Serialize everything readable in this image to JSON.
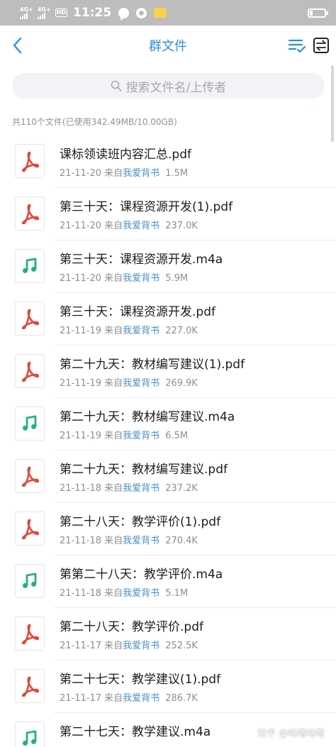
{
  "status_bar": {
    "sim1_network": "4G+",
    "sim2_network": "4G+",
    "hd_label": "HD",
    "time": "11:25",
    "battery_level": 0.2,
    "icons": [
      "chat-bubble-icon",
      "browser-icon",
      "app-icon"
    ]
  },
  "nav": {
    "title": "群文件",
    "back_icon": "chevron-left-icon",
    "sort_icon": "sort-check-icon",
    "transfer_icon": "transfer-icon"
  },
  "search": {
    "placeholder": "搜索文件名/上传者"
  },
  "summary": "共110个文件(已使用342.49MB/10.00GB)",
  "meta_prefix": "来自",
  "files": [
    {
      "name": "课标领读班内容汇总.pdf",
      "date": "21-11-20",
      "uploader": "我爱背书",
      "size": "1.5M",
      "type": "pdf"
    },
    {
      "name": "第三十天：课程资源开发(1).pdf",
      "date": "21-11-20",
      "uploader": "我爱背书",
      "size": "237.0K",
      "type": "pdf"
    },
    {
      "name": "第三十天：课程资源开发.m4a",
      "date": "21-11-20",
      "uploader": "我爱背书",
      "size": "5.9M",
      "type": "audio"
    },
    {
      "name": "第三十天：课程资源开发.pdf",
      "date": "21-11-19",
      "uploader": "我爱背书",
      "size": "227.0K",
      "type": "pdf"
    },
    {
      "name": "第二十九天：教材编写建议(1).pdf",
      "date": "21-11-19",
      "uploader": "我爱背书",
      "size": "269.9K",
      "type": "pdf"
    },
    {
      "name": "第二十九天：教材编写建议.m4a",
      "date": "21-11-19",
      "uploader": "我爱背书",
      "size": "6.5M",
      "type": "audio"
    },
    {
      "name": "第二十九天：教材编写建议.pdf",
      "date": "21-11-18",
      "uploader": "我爱背书",
      "size": "237.2K",
      "type": "pdf"
    },
    {
      "name": "第二十八天：教学评价(1).pdf",
      "date": "21-11-18",
      "uploader": "我爱背书",
      "size": "270.4K",
      "type": "pdf"
    },
    {
      "name": "第第二十八天：教学评价.m4a",
      "date": "21-11-18",
      "uploader": "我爱背书",
      "size": "5.1M",
      "type": "audio"
    },
    {
      "name": "第二十八天：教学评价.pdf",
      "date": "21-11-17",
      "uploader": "我爱背书",
      "size": "252.5K",
      "type": "pdf"
    },
    {
      "name": "第二十七天：教学建议(1).pdf",
      "date": "21-11-17",
      "uploader": "我爱背书",
      "size": "286.7K",
      "type": "pdf"
    },
    {
      "name": "第二十七天：教学建议.m4a",
      "date": "",
      "uploader": "",
      "size": "",
      "type": "audio"
    }
  ],
  "watermark": "知乎 @咕噜咕噜",
  "colors": {
    "accent": "#2f8fd8",
    "uploader": "#4a90c9",
    "pdf_icon": "#e0493c",
    "audio_icon": "#27b07d",
    "status_bar": "#bdbdbd"
  }
}
